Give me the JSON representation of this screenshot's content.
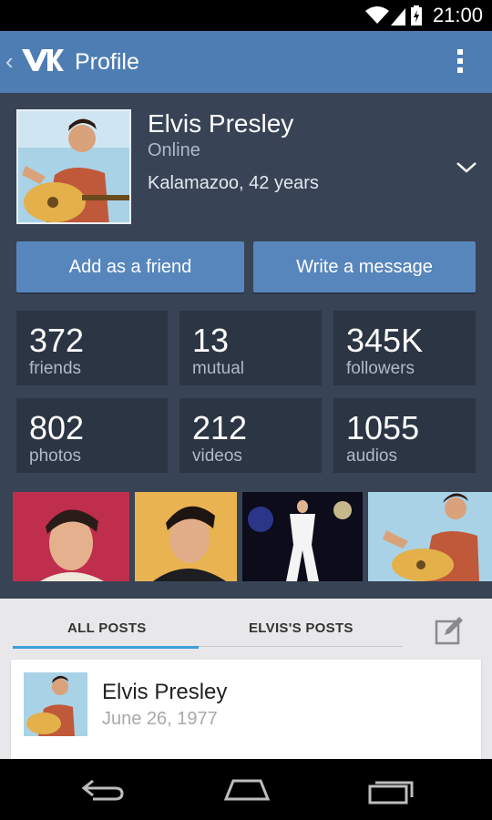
{
  "status_bar": {
    "time": "21:00"
  },
  "appbar": {
    "title": "Profile",
    "logo": "VK"
  },
  "profile": {
    "name": "Elvis Presley",
    "status": "Online",
    "location": "Kalamazoo, 42 years"
  },
  "actions": {
    "add_friend": "Add as a friend",
    "write_message": "Write a message"
  },
  "stats": [
    {
      "value": "372",
      "label": "friends"
    },
    {
      "value": "13",
      "label": "mutual"
    },
    {
      "value": "345K",
      "label": "followers"
    },
    {
      "value": "802",
      "label": "photos"
    },
    {
      "value": "212",
      "label": "videos"
    },
    {
      "value": "1055",
      "label": "audios"
    }
  ],
  "tabs": {
    "all_posts": "ALL POSTS",
    "elvis_posts": "ELVIS'S POSTS"
  },
  "post": {
    "author": "Elvis Presley",
    "date": "June 26, 1977"
  },
  "colors": {
    "appbar": "#4e7db3",
    "panel": "#384355",
    "tile": "#2c3543",
    "button": "#5786bc",
    "accent": "#3c9fd9"
  }
}
